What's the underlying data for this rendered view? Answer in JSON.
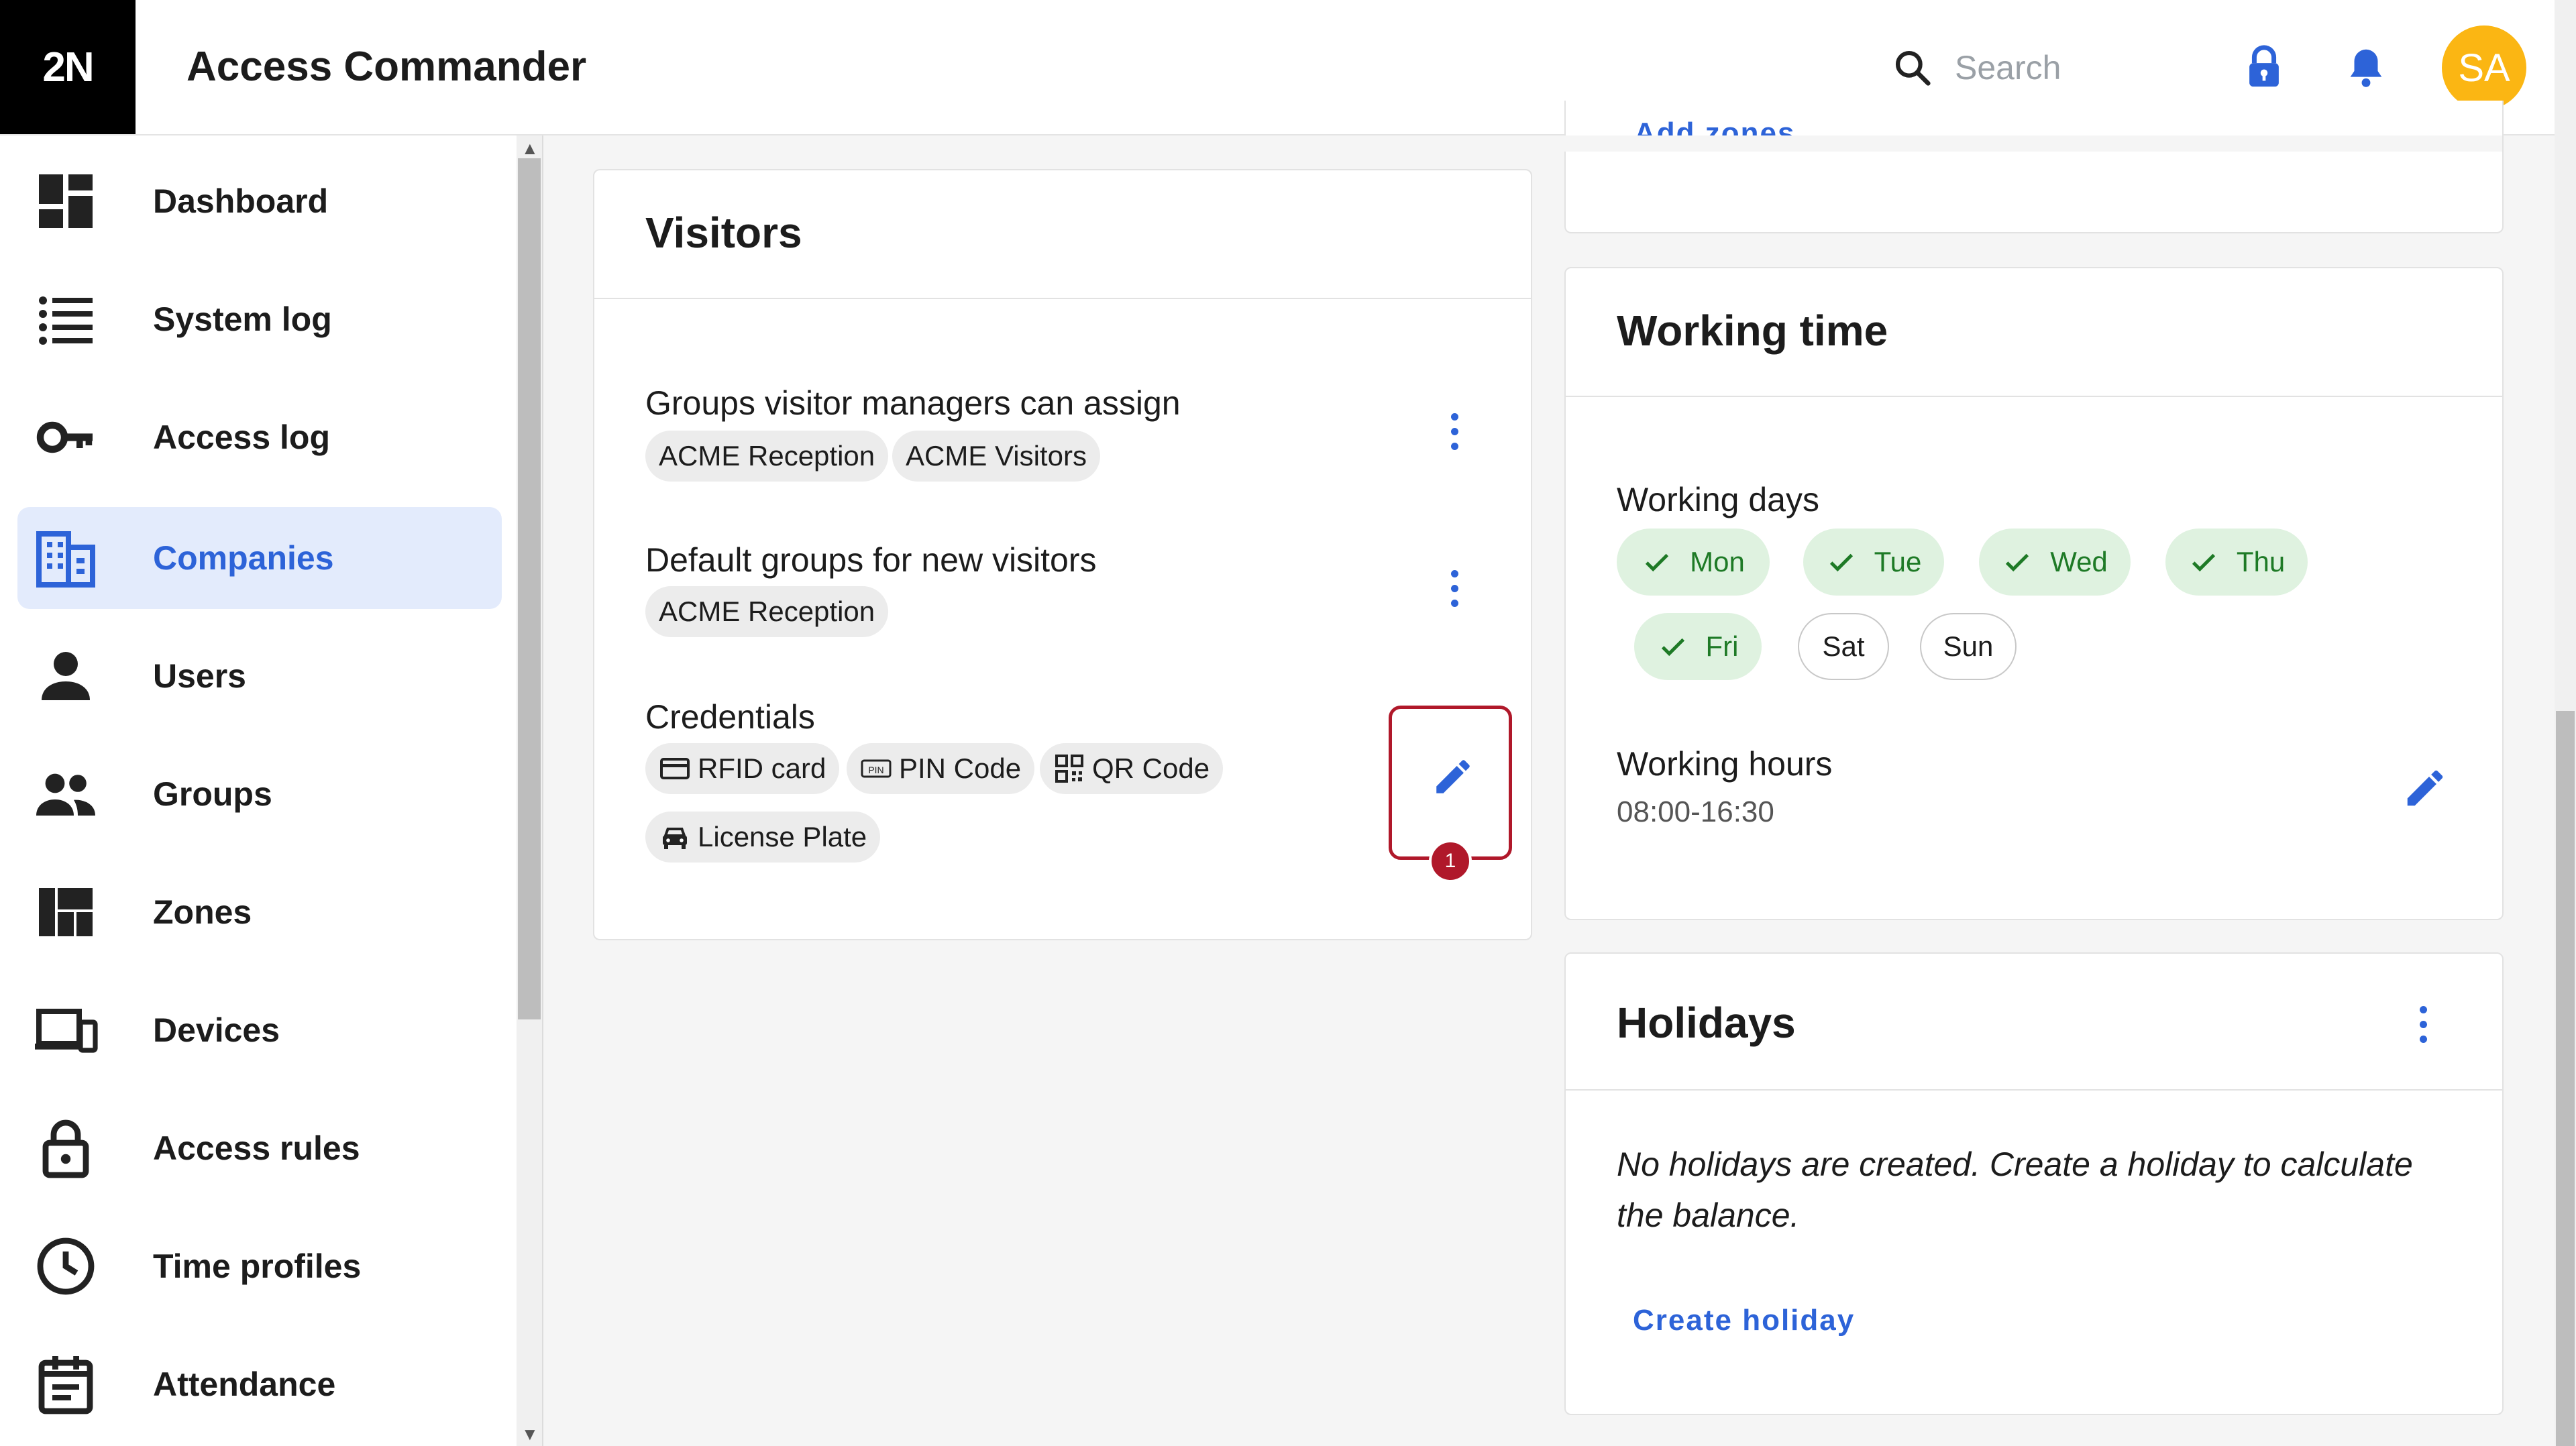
{
  "app": {
    "logo": "2N",
    "title": "Access Commander"
  },
  "header": {
    "search_placeholder": "Search",
    "avatar_initials": "SA"
  },
  "sidebar": {
    "items": [
      {
        "label": "Dashboard",
        "icon": "dashboard-icon"
      },
      {
        "label": "System log",
        "icon": "list-icon"
      },
      {
        "label": "Access log",
        "icon": "key-icon"
      },
      {
        "label": "Companies",
        "icon": "building-icon",
        "active": true
      },
      {
        "label": "Users",
        "icon": "person-icon"
      },
      {
        "label": "Groups",
        "icon": "people-icon"
      },
      {
        "label": "Zones",
        "icon": "zones-icon"
      },
      {
        "label": "Devices",
        "icon": "devices-icon"
      },
      {
        "label": "Access rules",
        "icon": "lock-icon"
      },
      {
        "label": "Time profiles",
        "icon": "clock-icon"
      },
      {
        "label": "Attendance",
        "icon": "calendar-icon"
      }
    ]
  },
  "visitors": {
    "title": "Visitors",
    "managers_label": "Groups visitor managers can assign",
    "managers_groups": [
      "ACME Reception",
      "ACME Visitors"
    ],
    "default_label": "Default groups for new visitors",
    "default_groups": [
      "ACME Reception"
    ],
    "credentials_label": "Credentials",
    "credentials": [
      {
        "label": "RFID card",
        "icon": "card-icon"
      },
      {
        "label": "PIN Code",
        "icon": "pin-icon"
      },
      {
        "label": "QR Code",
        "icon": "qr-icon"
      },
      {
        "label": "License Plate",
        "icon": "car-icon"
      }
    ],
    "edit_badge": "1"
  },
  "zones_card": {
    "link": "Add zones"
  },
  "working_time": {
    "title": "Working time",
    "days_label": "Working days",
    "days": [
      {
        "label": "Mon",
        "on": true
      },
      {
        "label": "Tue",
        "on": true
      },
      {
        "label": "Wed",
        "on": true
      },
      {
        "label": "Thu",
        "on": true
      },
      {
        "label": "Fri",
        "on": true
      },
      {
        "label": "Sat",
        "on": false
      },
      {
        "label": "Sun",
        "on": false
      }
    ],
    "hours_label": "Working hours",
    "hours_value": "08:00-16:30"
  },
  "holidays": {
    "title": "Holidays",
    "empty_text": "No holidays are created. Create a holiday to calculate the balance.",
    "create_link": "Create holiday"
  },
  "colors": {
    "accent": "#2d63d8",
    "active_bg": "#e3ebfc",
    "day_on_bg": "#dff2e0",
    "day_on_text": "#1e7a26",
    "highlight": "#b0182a",
    "avatar": "#fbb613"
  }
}
